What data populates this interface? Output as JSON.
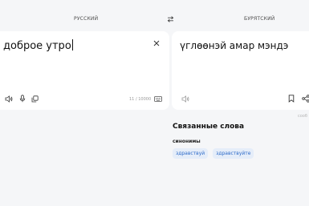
{
  "languages": {
    "source": "РУССКИЙ",
    "target": "БУРЯТСКИЙ"
  },
  "source": {
    "text": "доброе утро",
    "counter": "11 / 10000"
  },
  "translation": {
    "text": "үглөөнэй амар мэндэ"
  },
  "right_note": "сооб",
  "related": {
    "title": "Связанные слова",
    "synonyms_title": "синонимы",
    "synonyms": [
      "здравствуй",
      "здравствуйте"
    ]
  },
  "colors": {
    "accent": "#2f6cc9",
    "chip_bg": "#e5edf9",
    "page_bg": "#f5f6f8"
  },
  "icons": {
    "swap": "swap-icon",
    "clear": "close-icon",
    "listen": "speaker-icon",
    "mic": "microphone-icon",
    "copy": "copy-icon",
    "keyboard": "keyboard-icon",
    "bookmark": "bookmark-icon",
    "share": "share-icon"
  }
}
